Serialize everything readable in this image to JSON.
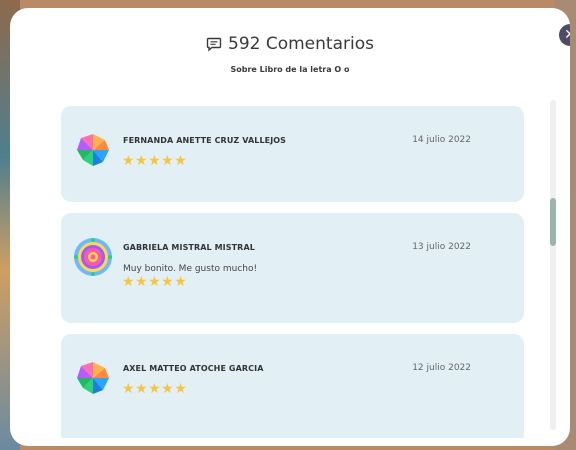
{
  "modal": {
    "title": "592 Comentarios",
    "subtitle": "Sobre Libro de la letra O o",
    "close_label": "✕"
  },
  "comments": [
    {
      "name": "FERNANDA ANETTE CRUZ VALLEJOS",
      "date": "14 julio 2022",
      "text": "",
      "rating": 5,
      "stars": "★★★★★",
      "avatar": "pinwheel-avatar"
    },
    {
      "name": "GABRIELA MISTRAL MISTRAL",
      "date": "13 julio 2022",
      "text": "Muy bonito. Me gusto mucho!",
      "rating": 5,
      "stars": "★★★★★",
      "avatar": "mandala-avatar"
    },
    {
      "name": "AXEL MATTEO ATOCHE GARCIA",
      "date": "12 julio 2022",
      "text": "",
      "rating": 5,
      "stars": "★★★★★",
      "avatar": "pinwheel-avatar"
    }
  ],
  "colors": {
    "card_bg": "#e2f0f6",
    "star": "#f5c542",
    "close_button": "#4e4b66",
    "scroll_thumb": "#9bb5ae"
  }
}
